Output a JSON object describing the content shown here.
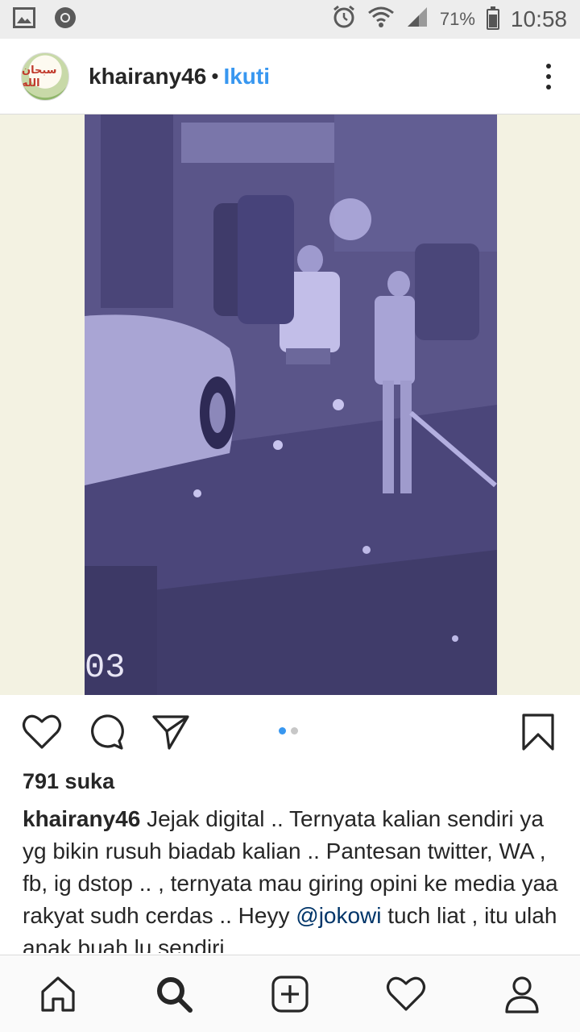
{
  "status_bar": {
    "battery": "71%",
    "time": "10:58",
    "battery_level": 0.71
  },
  "post": {
    "username": "khairany46",
    "separator": "•",
    "follow_label": "Ikuti",
    "avatar_text": "سبحان الله",
    "video_overlay_text": "03",
    "carousel": {
      "count": 2,
      "active": 0
    },
    "likes": "791 suka",
    "caption": {
      "username": "khairany46",
      "text_before_mention": " Jejak digital .. Ternyata kalian sendiri ya yg bikin rusuh biadab kalian .. Pantesan twitter, WA , fb, ig dstop .. ,  ternyata mau giring opini ke media yaa rakyat sudh cerdas .. Heyy ",
      "mention": "@jokowi",
      "text_after_mention": " tuch liat , itu ulah anak buah lu sendiri.."
    }
  },
  "icons": {
    "status_left": [
      "gallery-icon",
      "chrome-icon"
    ],
    "status_right": [
      "alarm-icon",
      "wifi-icon",
      "signal-icon",
      "battery-icon"
    ],
    "actions": [
      "heart-icon",
      "comment-icon",
      "share-icon",
      "bookmark-icon"
    ],
    "nav": [
      "home-icon",
      "search-icon",
      "add-post-icon",
      "activity-heart-icon",
      "profile-icon"
    ]
  },
  "colors": {
    "accent": "#3897f0",
    "text": "#262626",
    "mention": "#003569"
  }
}
